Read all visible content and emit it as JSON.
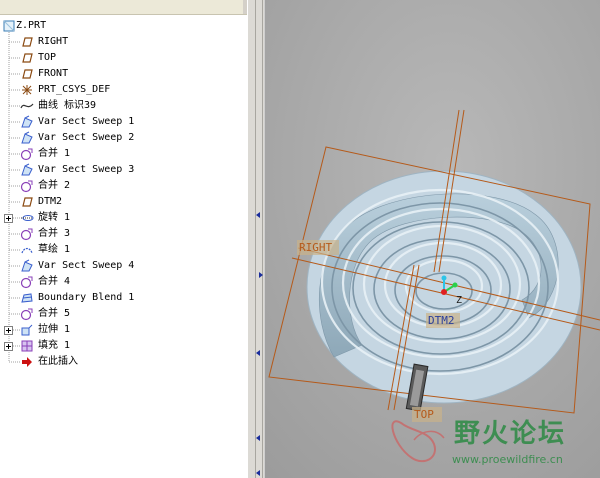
{
  "model_tree": {
    "root": {
      "label": "Z.PRT",
      "icon": "part-icon"
    },
    "items": [
      {
        "label": "RIGHT",
        "icon": "datum-plane-icon",
        "expandable": false
      },
      {
        "label": "TOP",
        "icon": "datum-plane-icon",
        "expandable": false
      },
      {
        "label": "FRONT",
        "icon": "datum-plane-icon",
        "expandable": false
      },
      {
        "label": "PRT_CSYS_DEF",
        "icon": "coordinate-system-icon",
        "expandable": false
      },
      {
        "label": "曲线 标识39",
        "icon": "curve-icon",
        "expandable": false
      },
      {
        "label": "Var Sect Sweep 1",
        "icon": "sweep-icon",
        "expandable": false
      },
      {
        "label": "Var Sect Sweep 2",
        "icon": "sweep-icon",
        "expandable": false
      },
      {
        "label": "合并 1",
        "icon": "merge-icon",
        "expandable": false
      },
      {
        "label": "Var Sect Sweep 3",
        "icon": "sweep-icon",
        "expandable": false
      },
      {
        "label": "合并 2",
        "icon": "merge-icon",
        "expandable": false
      },
      {
        "label": "DTM2",
        "icon": "datum-plane-icon",
        "expandable": false
      },
      {
        "label": "旋转 1",
        "icon": "revolve-icon",
        "expandable": true
      },
      {
        "label": "合并 3",
        "icon": "merge-icon",
        "expandable": false
      },
      {
        "label": "草绘 1",
        "icon": "sketch-icon",
        "expandable": false
      },
      {
        "label": "Var Sect Sweep 4",
        "icon": "sweep-icon",
        "expandable": false
      },
      {
        "label": "合并 4",
        "icon": "merge-icon",
        "expandable": false
      },
      {
        "label": "Boundary Blend 1",
        "icon": "boundary-blend-icon",
        "expandable": false
      },
      {
        "label": "合并 5",
        "icon": "merge-icon",
        "expandable": false
      },
      {
        "label": "拉伸 1",
        "icon": "extrude-icon",
        "expandable": true
      },
      {
        "label": "填充 1",
        "icon": "fill-icon",
        "expandable": true
      },
      {
        "label": "在此插入",
        "icon": "insert-here-arrow-icon",
        "expandable": false
      }
    ]
  },
  "viewport": {
    "datum_labels": {
      "right": "RIGHT",
      "dtm2": "DTM2",
      "top": "TOP",
      "csys": "Z"
    }
  },
  "watermark": {
    "title": "野火论坛",
    "url": "www.proewildfire.cn"
  },
  "colors": {
    "datum_orange": "#b55a1a",
    "viewport_bg": "#a8a8a8",
    "disk": "#c5d6e2",
    "coil": "#a6bfcf",
    "watermark": "#2d8a44",
    "insert_arrow": "#cc1010",
    "icon_blue": "#3a5fcd",
    "icon_purple": "#8a40b8"
  }
}
